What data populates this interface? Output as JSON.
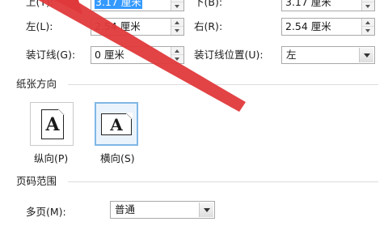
{
  "margins": {
    "top_label": "上(T):",
    "top_value": "3.17 厘米",
    "bottom_label": "下(B):",
    "bottom_value": "3.17 厘米",
    "left_label": "左(L):",
    "left_value": "2.54 厘米",
    "right_label": "右(R):",
    "right_value": "2.54 厘米",
    "gutter_label": "装订线(G):",
    "gutter_value": "0 厘米",
    "gutter_pos_label": "装订线位置(U):",
    "gutter_pos_value": "左"
  },
  "orientation": {
    "section_title": "纸张方向",
    "portrait_label": "纵向(P)",
    "landscape_label": "横向(S)",
    "icon_letter": "A",
    "selected": "landscape"
  },
  "pages": {
    "section_title": "页码范围",
    "multiple_label": "多页(M):",
    "multiple_value": "普通"
  },
  "colors": {
    "annotation_arrow": "#e0393b",
    "selection_highlight": "#3399ff"
  }
}
